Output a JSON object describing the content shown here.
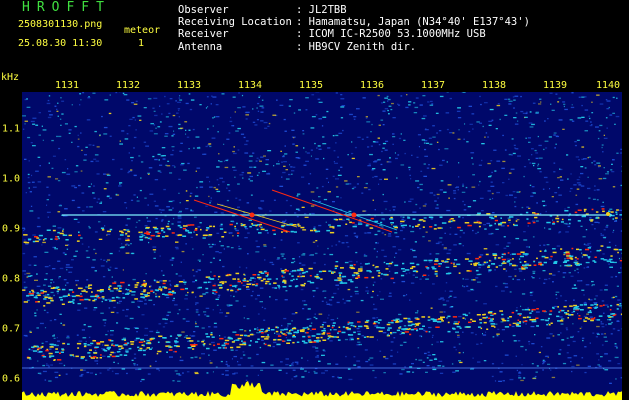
{
  "colors": {
    "title": "#40e040",
    "info": "#ffff40",
    "meta_text": "#ffffff",
    "axis_text": "#ffff40",
    "background": "#000000",
    "plot_background": "#00086a",
    "noise_low": "#1e4ed8",
    "noise_mid": "#22c8e8",
    "noise_high": "#f0d020",
    "hot": "#ff2a10",
    "carrier": "#7df0ff",
    "baseline": "#ffff00"
  },
  "header": {
    "title": "HROFFT",
    "filename": "2508301130.png",
    "meteor_label": "meteor",
    "datetime": "25.08.30 11:30",
    "meteor_count": "1"
  },
  "meta": [
    {
      "key": "Observer",
      "value": ": JL2TBB"
    },
    {
      "key": "Receiving Location",
      "value": ": Hamamatsu, Japan (N34°40' E137°43')"
    },
    {
      "key": "Receiver",
      "value": ": ICOM IC-R2500 53.1000MHz USB"
    },
    {
      "key": "Antenna",
      "value": ": HB9CV Zenith dir."
    }
  ],
  "axis": {
    "unit": "kHz",
    "x_ticks": [
      "1131",
      "1132",
      "1133",
      "1134",
      "1135",
      "1136",
      "1137",
      "1138",
      "1139",
      "1140"
    ],
    "y_ticks": [
      "1.1",
      "1.0",
      "0.9",
      "0.8",
      "0.7",
      "0.6"
    ]
  }
}
